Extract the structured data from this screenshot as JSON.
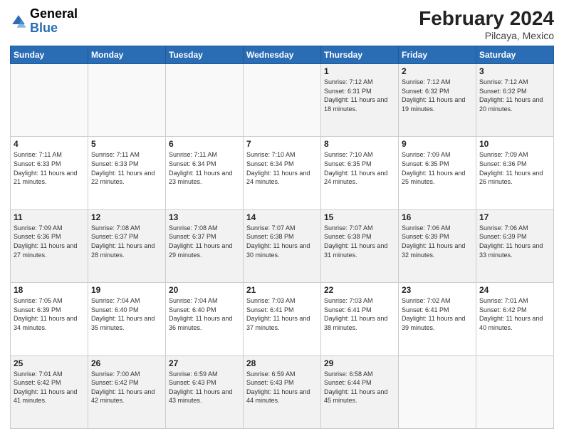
{
  "header": {
    "logo_general": "General",
    "logo_blue": "Blue",
    "title": "February 2024",
    "location": "Pilcaya, Mexico"
  },
  "days_of_week": [
    "Sunday",
    "Monday",
    "Tuesday",
    "Wednesday",
    "Thursday",
    "Friday",
    "Saturday"
  ],
  "weeks": [
    [
      {
        "day": "",
        "info": ""
      },
      {
        "day": "",
        "info": ""
      },
      {
        "day": "",
        "info": ""
      },
      {
        "day": "",
        "info": ""
      },
      {
        "day": "1",
        "info": "Sunrise: 7:12 AM\nSunset: 6:31 PM\nDaylight: 11 hours and 18 minutes."
      },
      {
        "day": "2",
        "info": "Sunrise: 7:12 AM\nSunset: 6:32 PM\nDaylight: 11 hours and 19 minutes."
      },
      {
        "day": "3",
        "info": "Sunrise: 7:12 AM\nSunset: 6:32 PM\nDaylight: 11 hours and 20 minutes."
      }
    ],
    [
      {
        "day": "4",
        "info": "Sunrise: 7:11 AM\nSunset: 6:33 PM\nDaylight: 11 hours and 21 minutes."
      },
      {
        "day": "5",
        "info": "Sunrise: 7:11 AM\nSunset: 6:33 PM\nDaylight: 11 hours and 22 minutes."
      },
      {
        "day": "6",
        "info": "Sunrise: 7:11 AM\nSunset: 6:34 PM\nDaylight: 11 hours and 23 minutes."
      },
      {
        "day": "7",
        "info": "Sunrise: 7:10 AM\nSunset: 6:34 PM\nDaylight: 11 hours and 24 minutes."
      },
      {
        "day": "8",
        "info": "Sunrise: 7:10 AM\nSunset: 6:35 PM\nDaylight: 11 hours and 24 minutes."
      },
      {
        "day": "9",
        "info": "Sunrise: 7:09 AM\nSunset: 6:35 PM\nDaylight: 11 hours and 25 minutes."
      },
      {
        "day": "10",
        "info": "Sunrise: 7:09 AM\nSunset: 6:36 PM\nDaylight: 11 hours and 26 minutes."
      }
    ],
    [
      {
        "day": "11",
        "info": "Sunrise: 7:09 AM\nSunset: 6:36 PM\nDaylight: 11 hours and 27 minutes."
      },
      {
        "day": "12",
        "info": "Sunrise: 7:08 AM\nSunset: 6:37 PM\nDaylight: 11 hours and 28 minutes."
      },
      {
        "day": "13",
        "info": "Sunrise: 7:08 AM\nSunset: 6:37 PM\nDaylight: 11 hours and 29 minutes."
      },
      {
        "day": "14",
        "info": "Sunrise: 7:07 AM\nSunset: 6:38 PM\nDaylight: 11 hours and 30 minutes."
      },
      {
        "day": "15",
        "info": "Sunrise: 7:07 AM\nSunset: 6:38 PM\nDaylight: 11 hours and 31 minutes."
      },
      {
        "day": "16",
        "info": "Sunrise: 7:06 AM\nSunset: 6:39 PM\nDaylight: 11 hours and 32 minutes."
      },
      {
        "day": "17",
        "info": "Sunrise: 7:06 AM\nSunset: 6:39 PM\nDaylight: 11 hours and 33 minutes."
      }
    ],
    [
      {
        "day": "18",
        "info": "Sunrise: 7:05 AM\nSunset: 6:39 PM\nDaylight: 11 hours and 34 minutes."
      },
      {
        "day": "19",
        "info": "Sunrise: 7:04 AM\nSunset: 6:40 PM\nDaylight: 11 hours and 35 minutes."
      },
      {
        "day": "20",
        "info": "Sunrise: 7:04 AM\nSunset: 6:40 PM\nDaylight: 11 hours and 36 minutes."
      },
      {
        "day": "21",
        "info": "Sunrise: 7:03 AM\nSunset: 6:41 PM\nDaylight: 11 hours and 37 minutes."
      },
      {
        "day": "22",
        "info": "Sunrise: 7:03 AM\nSunset: 6:41 PM\nDaylight: 11 hours and 38 minutes."
      },
      {
        "day": "23",
        "info": "Sunrise: 7:02 AM\nSunset: 6:41 PM\nDaylight: 11 hours and 39 minutes."
      },
      {
        "day": "24",
        "info": "Sunrise: 7:01 AM\nSunset: 6:42 PM\nDaylight: 11 hours and 40 minutes."
      }
    ],
    [
      {
        "day": "25",
        "info": "Sunrise: 7:01 AM\nSunset: 6:42 PM\nDaylight: 11 hours and 41 minutes."
      },
      {
        "day": "26",
        "info": "Sunrise: 7:00 AM\nSunset: 6:42 PM\nDaylight: 11 hours and 42 minutes."
      },
      {
        "day": "27",
        "info": "Sunrise: 6:59 AM\nSunset: 6:43 PM\nDaylight: 11 hours and 43 minutes."
      },
      {
        "day": "28",
        "info": "Sunrise: 6:59 AM\nSunset: 6:43 PM\nDaylight: 11 hours and 44 minutes."
      },
      {
        "day": "29",
        "info": "Sunrise: 6:58 AM\nSunset: 6:44 PM\nDaylight: 11 hours and 45 minutes."
      },
      {
        "day": "",
        "info": ""
      },
      {
        "day": "",
        "info": ""
      }
    ]
  ]
}
